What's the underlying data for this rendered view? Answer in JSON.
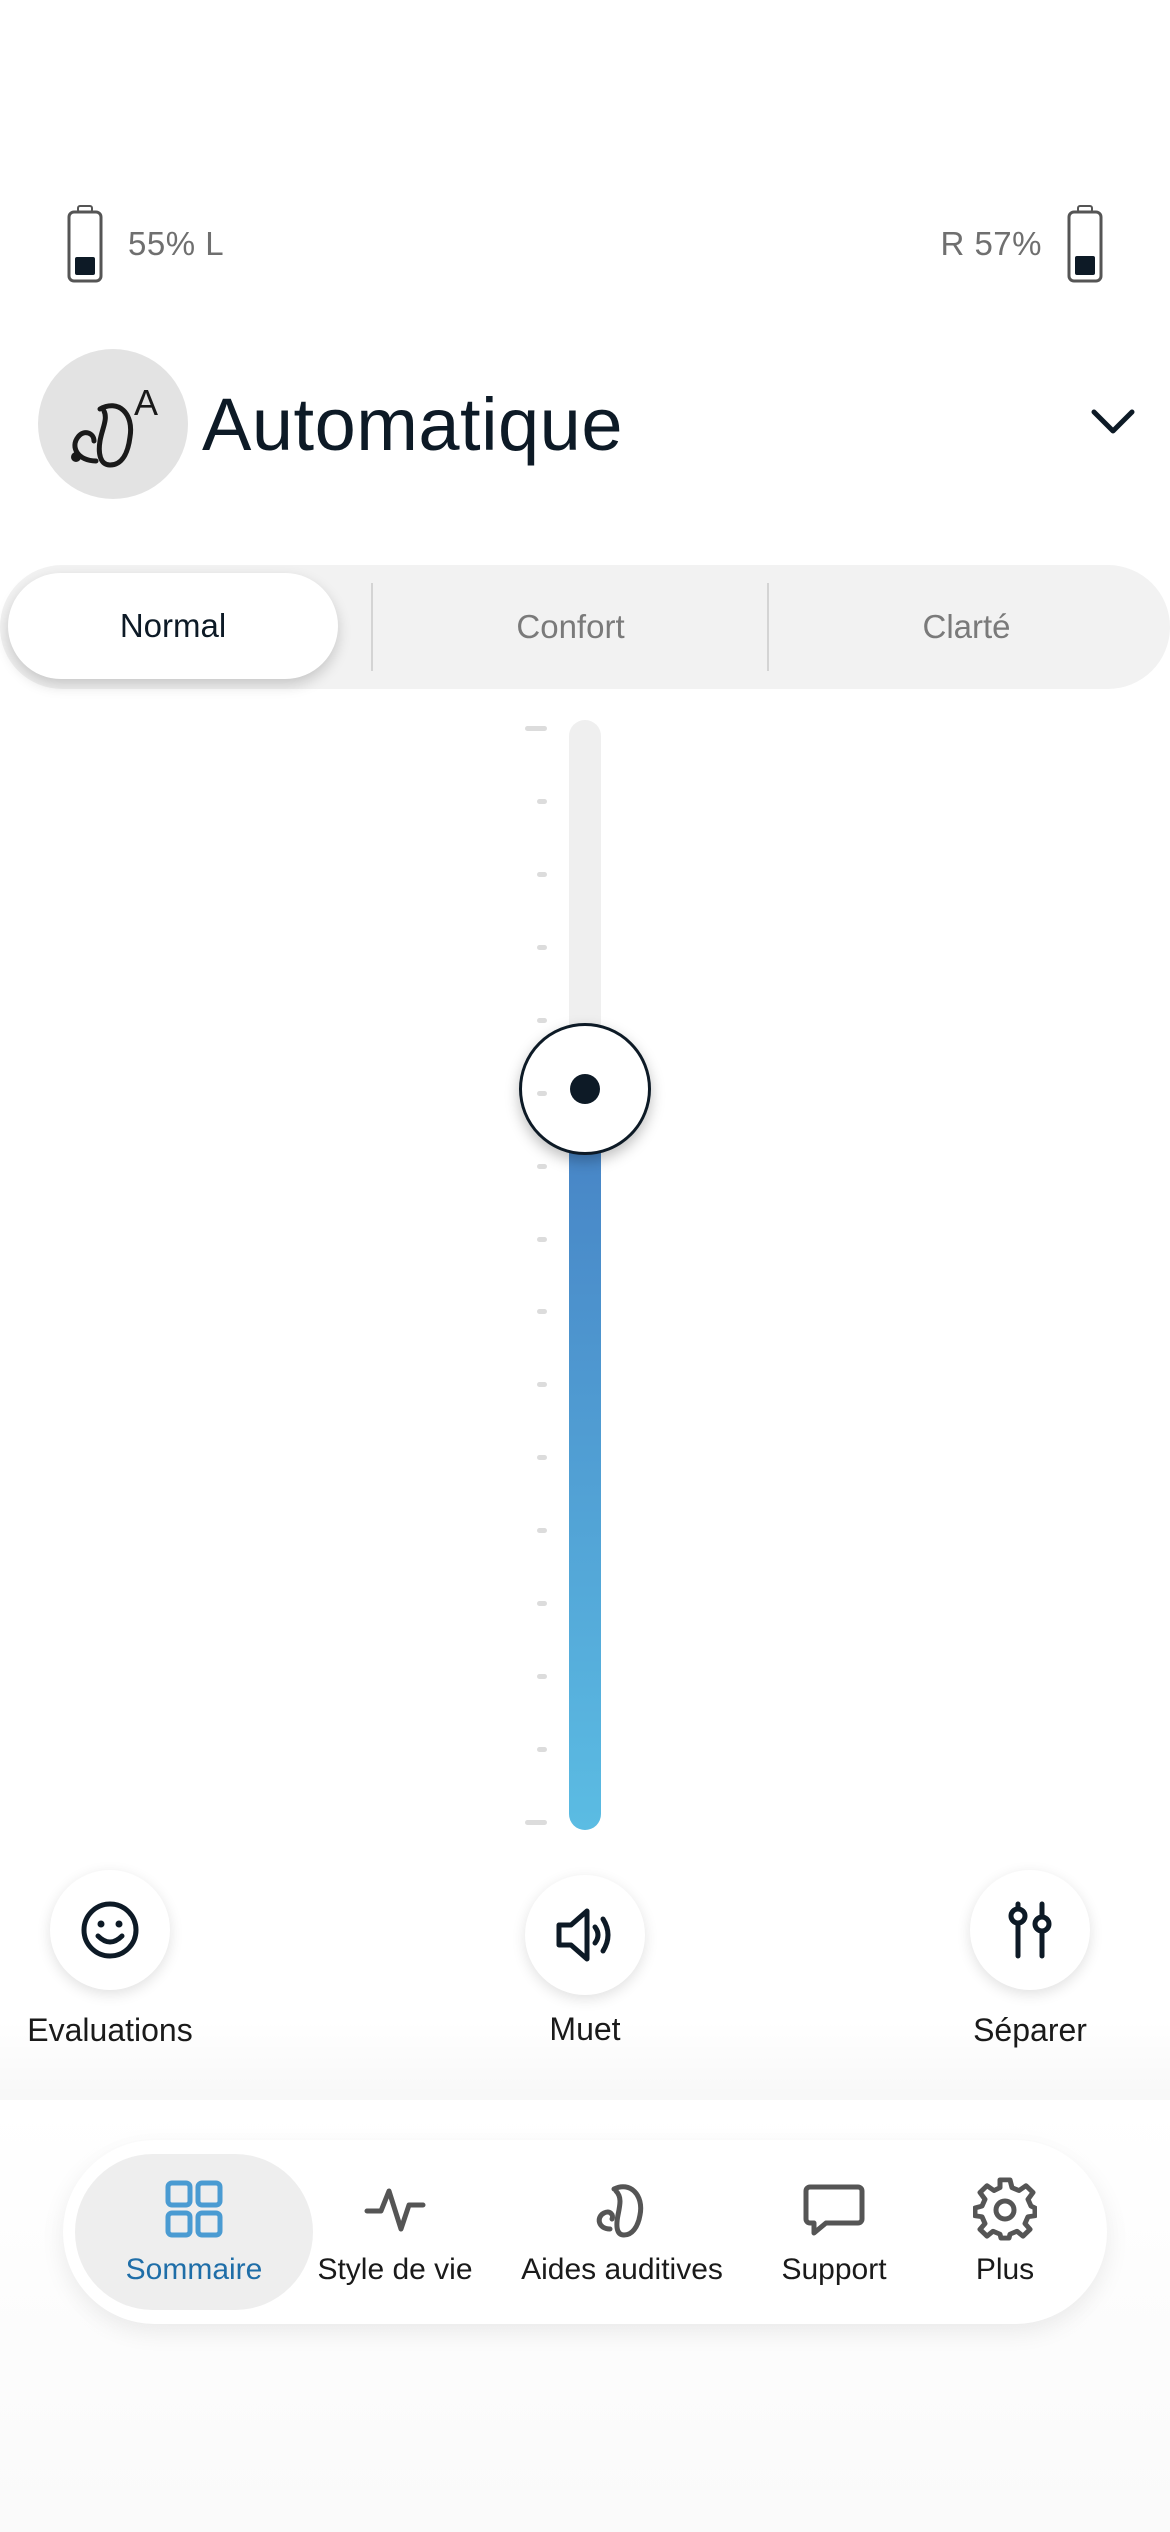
{
  "battery": {
    "left": {
      "text": "55% L",
      "level_percent": 55
    },
    "right": {
      "text": "R 57%",
      "level_percent": 57
    }
  },
  "program": {
    "avatar_badge": "A",
    "title": "Automatique"
  },
  "segments": {
    "items": [
      {
        "label": "Normal",
        "active": true
      },
      {
        "label": "Confort",
        "active": false
      },
      {
        "label": "Clarté",
        "active": false
      }
    ]
  },
  "volume_slider": {
    "level_fraction": 0.67,
    "tick_count": 16,
    "fill_color_top": "#4681c4",
    "fill_color_bottom": "#5bbce3"
  },
  "actions": {
    "evaluations": {
      "label": "Evaluations",
      "icon": "smiley-icon"
    },
    "mute": {
      "label": "Muet",
      "icon": "speaker-icon"
    },
    "split": {
      "label": "Séparer",
      "icon": "sliders-icon"
    }
  },
  "nav": {
    "items": [
      {
        "label": "Sommaire",
        "icon": "grid-icon",
        "active": true
      },
      {
        "label": "Style de vie",
        "icon": "activity-icon",
        "active": false
      },
      {
        "label": "Aides auditives",
        "icon": "hearing-aid-icon",
        "active": false
      },
      {
        "label": "Support",
        "icon": "chat-bubble-icon",
        "active": false
      },
      {
        "label": "Plus",
        "icon": "gear-icon",
        "active": false
      }
    ],
    "active_color": "#1f6ea8",
    "active_icon_color": "#4a9bd2"
  }
}
